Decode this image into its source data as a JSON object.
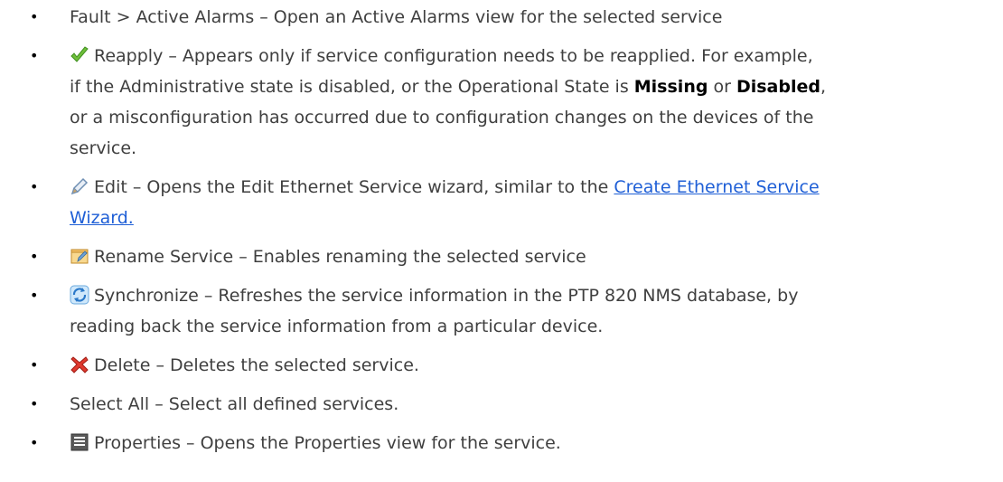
{
  "items": [
    {
      "text": "Fault > Active Alarms – Open an Active Alarms view for the selected service"
    },
    {
      "icon": "checkmark-icon",
      "label": "Reapply",
      "line1_text": " – Appears only if service configuration needs to be reapplied. For example,",
      "line2_pre": "if the Administrative state is disabled, or the Operational State is ",
      "missing": "Missing",
      "or": " or ",
      "disabled": "Disabled",
      "line2_post": ",",
      "line3": "or a misconfiguration has occurred due to configuration changes on the devices of the",
      "line4": "service."
    },
    {
      "icon": "pencil-icon",
      "line1_text": "Edit – Opens the Edit Ethernet Service wizard, similar to the ",
      "link_part1": "Create Ethernet Service",
      "link_part2": "Wizard."
    },
    {
      "icon": "folder-rename-icon",
      "text": "Rename Service – Enables renaming the selected service"
    },
    {
      "icon": "sync-icon",
      "line1": "Synchronize – Refreshes the service information in the PTP 820 NMS database, by",
      "line2": "reading back the service information from a particular device."
    },
    {
      "icon": "delete-x-icon",
      "text": "Delete – Deletes the selected service."
    },
    {
      "text": "Select All – Select all defined services."
    },
    {
      "icon": "properties-icon",
      "text": "Properties – Opens the Properties view for the service."
    }
  ],
  "bullet": "•"
}
